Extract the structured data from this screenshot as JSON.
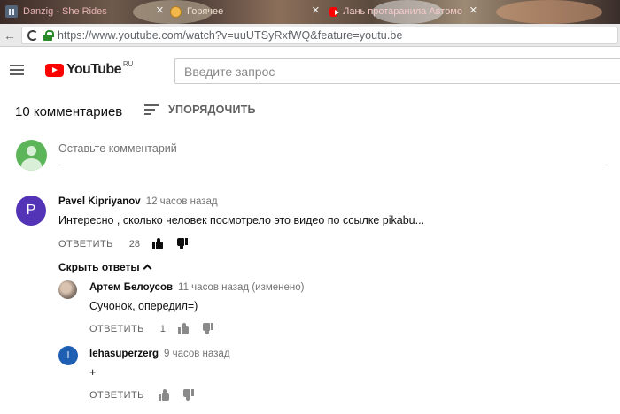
{
  "browser": {
    "tabs": [
      {
        "title": "Danzig - She Rides",
        "icon": "pause-icon"
      },
      {
        "title": "Горячее",
        "icon": "emoji-face-icon"
      },
      {
        "title": "Лань протаранила Автомо",
        "icon": "youtube-favicon"
      }
    ],
    "url": "https://www.youtube.com/watch?v=uuUTSyRxfWQ&feature=youtu.be"
  },
  "youtube": {
    "logo_text": "YouTube",
    "logo_region": "RU",
    "search_placeholder": "Введите запрос"
  },
  "comments_section": {
    "count_label": "10 комментариев",
    "sort_label": "УПОРЯДОЧИТЬ",
    "add_comment_placeholder": "Оставьте комментарий",
    "hide_replies_label": "Скрыть ответы",
    "reply_label": "ОТВЕТИТЬ",
    "comment": {
      "avatar_letter": "P",
      "author": "Pavel Kipriyanov",
      "time": "12 часов назад",
      "text": "Интересно , сколько человек посмотрело это видео по ссылке pikabu...",
      "likes": "28"
    },
    "replies": [
      {
        "author": "Артем Белоусов",
        "time": "11 часов назад (изменено)",
        "text": "Сучонок, опередил=)",
        "likes": "1"
      },
      {
        "avatar_letter": "l",
        "author": "lehasuperzerg",
        "time": "9 часов назад",
        "text": "+",
        "likes": ""
      }
    ]
  },
  "colors": {
    "youtube_red": "#ff0000",
    "avatar_default": "#5db559",
    "avatar_p": "#5434b6",
    "avatar_l": "#1f5fb3"
  }
}
